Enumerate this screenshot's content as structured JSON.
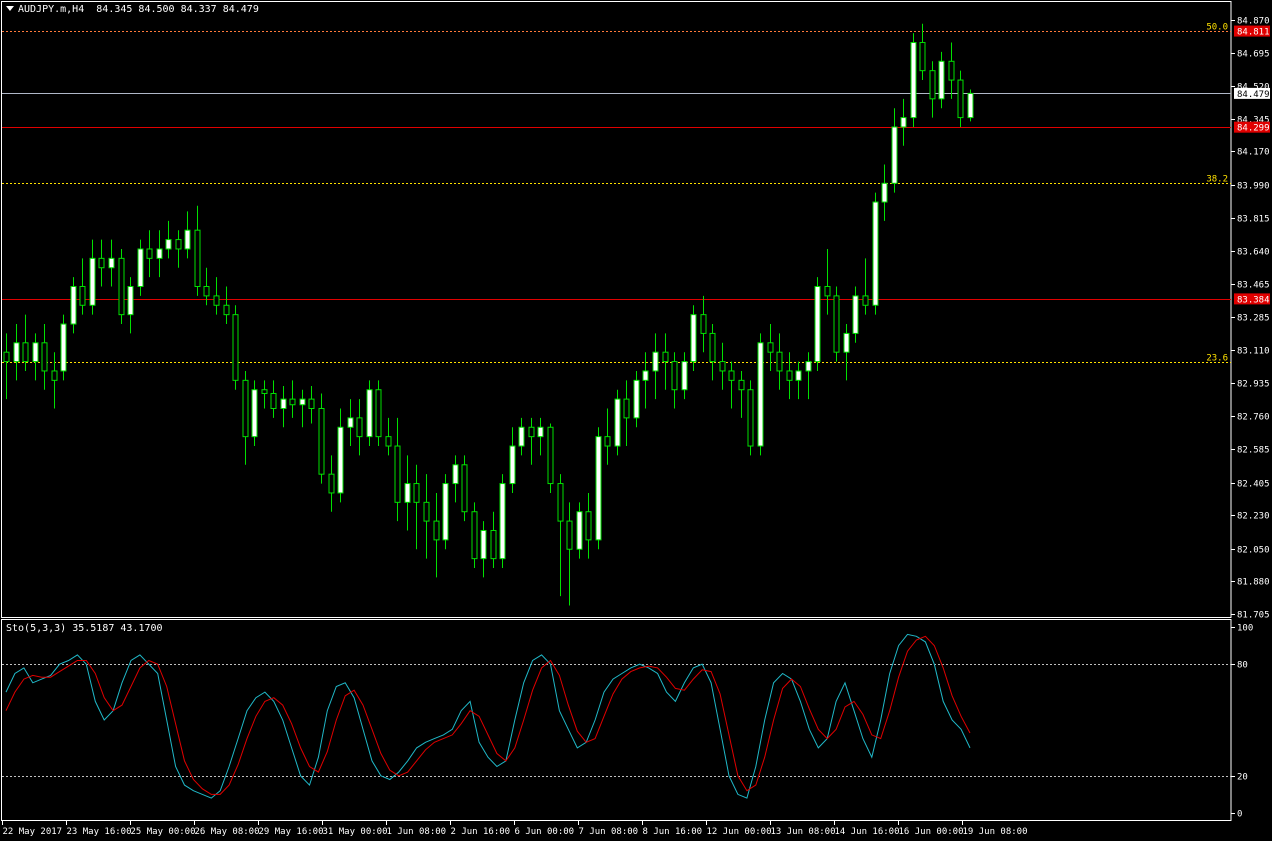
{
  "header": {
    "symbol": "AUDJPY.m,H4",
    "ohlc": "84.345 84.500 84.337 84.479"
  },
  "oscillator": {
    "label": "Sto(5,3,3) 35.5187 43.1700"
  },
  "colors": {
    "background": "#000000",
    "bull_candle": "#ffffff",
    "bear_candle": "#000000",
    "candle_outline": "#00e000",
    "level_red": "#e00000",
    "fib_yellow": "#ffe100",
    "bid_line": "#b0b8c8",
    "stoch_main": "#20b8c8",
    "stoch_signal": "#e00000",
    "axis": "#ffffff"
  },
  "chart_data": [
    {
      "type": "candlestick",
      "title": "AUDJPY.m,H4",
      "ylim": [
        81.705,
        84.87
      ],
      "y_ticks": [
        "84.870",
        "84.695",
        "84.520",
        "84.345",
        "84.170",
        "83.990",
        "83.815",
        "83.640",
        "83.465",
        "83.285",
        "83.110",
        "82.935",
        "82.760",
        "82.585",
        "82.405",
        "82.230",
        "82.050",
        "81.880",
        "81.705"
      ],
      "x_ticks": [
        "22 May 2017",
        "23 May 16:00",
        "25 May 00:00",
        "26 May 08:00",
        "29 May 16:00",
        "31 May 00:00",
        "1 Jun 08:00",
        "2 Jun 16:00",
        "6 Jun 00:00",
        "7 Jun 08:00",
        "8 Jun 16:00",
        "12 Jun 00:00",
        "13 Jun 08:00",
        "14 Jun 16:00",
        "16 Jun 00:00",
        "19 Jun 08:00"
      ],
      "price_levels": [
        {
          "label": "84.811",
          "value": 84.811,
          "style": "red-box"
        },
        {
          "label": "84.479",
          "value": 84.479,
          "style": "bid"
        },
        {
          "label": "84.299",
          "value": 84.299,
          "style": "red"
        },
        {
          "label": "83.384",
          "value": 83.384,
          "style": "red"
        }
      ],
      "fib_levels": [
        {
          "label": "50.0",
          "value": 84.811
        },
        {
          "label": "38.2",
          "value": 84.0
        },
        {
          "label": "23.6",
          "value": 83.05
        }
      ],
      "ohlc": [
        [
          83.1,
          83.2,
          82.85,
          83.05
        ],
        [
          83.05,
          83.25,
          82.95,
          83.15
        ],
        [
          83.15,
          83.3,
          83.0,
          83.05
        ],
        [
          83.05,
          83.2,
          82.95,
          83.15
        ],
        [
          83.15,
          83.25,
          82.9,
          83.0
        ],
        [
          83.0,
          83.1,
          82.8,
          82.95
        ],
        [
          83.0,
          83.3,
          82.95,
          83.25
        ],
        [
          83.25,
          83.5,
          83.2,
          83.45
        ],
        [
          83.45,
          83.6,
          83.3,
          83.35
        ],
        [
          83.35,
          83.7,
          83.3,
          83.6
        ],
        [
          83.6,
          83.7,
          83.45,
          83.55
        ],
        [
          83.55,
          83.7,
          83.45,
          83.6
        ],
        [
          83.6,
          83.65,
          83.25,
          83.3
        ],
        [
          83.3,
          83.5,
          83.2,
          83.45
        ],
        [
          83.45,
          83.7,
          83.4,
          83.65
        ],
        [
          83.65,
          83.75,
          83.5,
          83.6
        ],
        [
          83.6,
          83.75,
          83.5,
          83.65
        ],
        [
          83.65,
          83.8,
          83.6,
          83.7
        ],
        [
          83.7,
          83.75,
          83.55,
          83.65
        ],
        [
          83.65,
          83.85,
          83.6,
          83.75
        ],
        [
          83.75,
          83.88,
          83.4,
          83.45
        ],
        [
          83.45,
          83.55,
          83.35,
          83.4
        ],
        [
          83.4,
          83.5,
          83.3,
          83.35
        ],
        [
          83.35,
          83.45,
          83.25,
          83.3
        ],
        [
          83.3,
          83.35,
          82.9,
          82.95
        ],
        [
          82.95,
          83.0,
          82.5,
          82.65
        ],
        [
          82.65,
          82.95,
          82.6,
          82.9
        ],
        [
          82.9,
          82.95,
          82.8,
          82.88
        ],
        [
          82.88,
          82.95,
          82.75,
          82.8
        ],
        [
          82.8,
          82.92,
          82.7,
          82.85
        ],
        [
          82.85,
          82.95,
          82.75,
          82.82
        ],
        [
          82.82,
          82.9,
          82.7,
          82.85
        ],
        [
          82.85,
          82.92,
          82.72,
          82.8
        ],
        [
          82.8,
          82.88,
          82.4,
          82.45
        ],
        [
          82.45,
          82.55,
          82.25,
          82.35
        ],
        [
          82.35,
          82.8,
          82.3,
          82.7
        ],
        [
          82.7,
          82.85,
          82.6,
          82.75
        ],
        [
          82.75,
          82.85,
          82.55,
          82.65
        ],
        [
          82.65,
          82.95,
          82.6,
          82.9
        ],
        [
          82.9,
          82.95,
          82.6,
          82.65
        ],
        [
          82.65,
          82.75,
          82.55,
          82.6
        ],
        [
          82.6,
          82.75,
          82.2,
          82.3
        ],
        [
          82.3,
          82.55,
          82.15,
          82.4
        ],
        [
          82.4,
          82.5,
          82.05,
          82.3
        ],
        [
          82.3,
          82.45,
          82.0,
          82.2
        ],
        [
          82.2,
          82.35,
          81.9,
          82.1
        ],
        [
          82.1,
          82.45,
          82.05,
          82.4
        ],
        [
          82.4,
          82.55,
          82.3,
          82.5
        ],
        [
          82.5,
          82.55,
          82.2,
          82.25
        ],
        [
          82.25,
          82.3,
          81.95,
          82.0
        ],
        [
          82.0,
          82.2,
          81.9,
          82.15
        ],
        [
          82.15,
          82.25,
          81.95,
          82.0
        ],
        [
          82.0,
          82.45,
          81.95,
          82.4
        ],
        [
          82.4,
          82.7,
          82.35,
          82.6
        ],
        [
          82.6,
          82.75,
          82.55,
          82.7
        ],
        [
          82.7,
          82.75,
          82.5,
          82.65
        ],
        [
          82.65,
          82.75,
          82.55,
          82.7
        ],
        [
          82.7,
          82.72,
          82.35,
          82.4
        ],
        [
          82.4,
          82.45,
          81.8,
          82.2
        ],
        [
          82.2,
          82.3,
          81.75,
          82.05
        ],
        [
          82.05,
          82.3,
          82.0,
          82.25
        ],
        [
          82.25,
          82.35,
          82.0,
          82.1
        ],
        [
          82.1,
          82.7,
          82.05,
          82.65
        ],
        [
          82.65,
          82.8,
          82.5,
          82.6
        ],
        [
          82.6,
          82.9,
          82.55,
          82.85
        ],
        [
          82.85,
          82.95,
          82.6,
          82.75
        ],
        [
          82.75,
          83.0,
          82.7,
          82.95
        ],
        [
          82.95,
          83.1,
          82.8,
          83.0
        ],
        [
          83.0,
          83.2,
          82.85,
          83.1
        ],
        [
          83.1,
          83.2,
          82.9,
          83.05
        ],
        [
          83.05,
          83.1,
          82.8,
          82.9
        ],
        [
          82.9,
          83.1,
          82.85,
          83.05
        ],
        [
          83.05,
          83.35,
          83.0,
          83.3
        ],
        [
          83.3,
          83.4,
          83.1,
          83.2
        ],
        [
          83.2,
          83.25,
          82.95,
          83.05
        ],
        [
          83.05,
          83.15,
          82.9,
          83.0
        ],
        [
          83.0,
          83.05,
          82.8,
          82.95
        ],
        [
          82.95,
          83.0,
          82.75,
          82.9
        ],
        [
          82.9,
          82.95,
          82.55,
          82.6
        ],
        [
          82.6,
          83.2,
          82.55,
          83.15
        ],
        [
          83.15,
          83.25,
          83.0,
          83.1
        ],
        [
          83.1,
          83.2,
          82.9,
          83.0
        ],
        [
          83.0,
          83.1,
          82.85,
          82.95
        ],
        [
          82.95,
          83.05,
          82.85,
          83.0
        ],
        [
          83.0,
          83.1,
          82.85,
          83.05
        ],
        [
          83.05,
          83.5,
          83.0,
          83.45
        ],
        [
          83.45,
          83.65,
          83.3,
          83.4
        ],
        [
          83.4,
          83.45,
          83.05,
          83.1
        ],
        [
          83.1,
          83.25,
          82.95,
          83.2
        ],
        [
          83.2,
          83.45,
          83.15,
          83.4
        ],
        [
          83.4,
          83.6,
          83.3,
          83.35
        ],
        [
          83.35,
          83.95,
          83.3,
          83.9
        ],
        [
          83.9,
          84.1,
          83.8,
          84.0
        ],
        [
          84.0,
          84.4,
          83.95,
          84.3
        ],
        [
          84.3,
          84.45,
          84.2,
          84.35
        ],
        [
          84.35,
          84.8,
          84.3,
          84.75
        ],
        [
          84.75,
          84.85,
          84.55,
          84.6
        ],
        [
          84.6,
          84.65,
          84.35,
          84.45
        ],
        [
          84.45,
          84.7,
          84.4,
          84.65
        ],
        [
          84.65,
          84.75,
          84.45,
          84.55
        ],
        [
          84.55,
          84.6,
          84.3,
          84.35
        ],
        [
          84.35,
          84.5,
          84.33,
          84.479
        ]
      ]
    },
    {
      "type": "line",
      "title": "Sto(5,3,3) 35.5187 43.1700",
      "ylim": [
        0,
        100
      ],
      "y_ticks": [
        "100",
        "80",
        "20",
        "0"
      ],
      "levels": [
        80,
        20
      ],
      "series": [
        {
          "name": "main",
          "values": [
            65,
            75,
            78,
            70,
            72,
            74,
            80,
            82,
            85,
            80,
            60,
            50,
            55,
            70,
            82,
            85,
            80,
            75,
            50,
            25,
            15,
            12,
            10,
            8,
            12,
            25,
            40,
            55,
            62,
            65,
            60,
            50,
            35,
            20,
            15,
            30,
            55,
            68,
            70,
            62,
            45,
            28,
            20,
            18,
            22,
            28,
            35,
            38,
            40,
            42,
            45,
            55,
            60,
            38,
            30,
            25,
            28,
            50,
            70,
            82,
            85,
            80,
            55,
            45,
            35,
            38,
            50,
            65,
            72,
            75,
            78,
            80,
            78,
            75,
            65,
            60,
            70,
            78,
            80,
            70,
            45,
            20,
            10,
            8,
            25,
            50,
            70,
            75,
            72,
            60,
            45,
            35,
            40,
            60,
            70,
            55,
            40,
            30,
            50,
            75,
            90,
            96,
            95,
            92,
            80,
            60,
            50,
            45,
            35
          ]
        },
        {
          "name": "signal",
          "values": [
            55,
            65,
            72,
            74,
            73,
            73,
            76,
            79,
            82,
            82,
            75,
            62,
            55,
            58,
            68,
            78,
            82,
            80,
            68,
            48,
            28,
            18,
            13,
            10,
            10,
            15,
            26,
            40,
            52,
            60,
            62,
            58,
            48,
            35,
            25,
            22,
            33,
            50,
            63,
            66,
            58,
            45,
            32,
            23,
            20,
            22,
            28,
            34,
            38,
            40,
            42,
            48,
            55,
            52,
            42,
            32,
            28,
            35,
            50,
            66,
            78,
            82,
            74,
            58,
            44,
            38,
            40,
            52,
            64,
            72,
            76,
            78,
            79,
            78,
            73,
            67,
            66,
            72,
            77,
            76,
            64,
            42,
            20,
            12,
            15,
            30,
            50,
            67,
            72,
            68,
            56,
            45,
            40,
            45,
            57,
            60,
            53,
            42,
            40,
            55,
            73,
            87,
            93,
            95,
            90,
            78,
            63,
            52,
            43
          ]
        }
      ]
    }
  ]
}
